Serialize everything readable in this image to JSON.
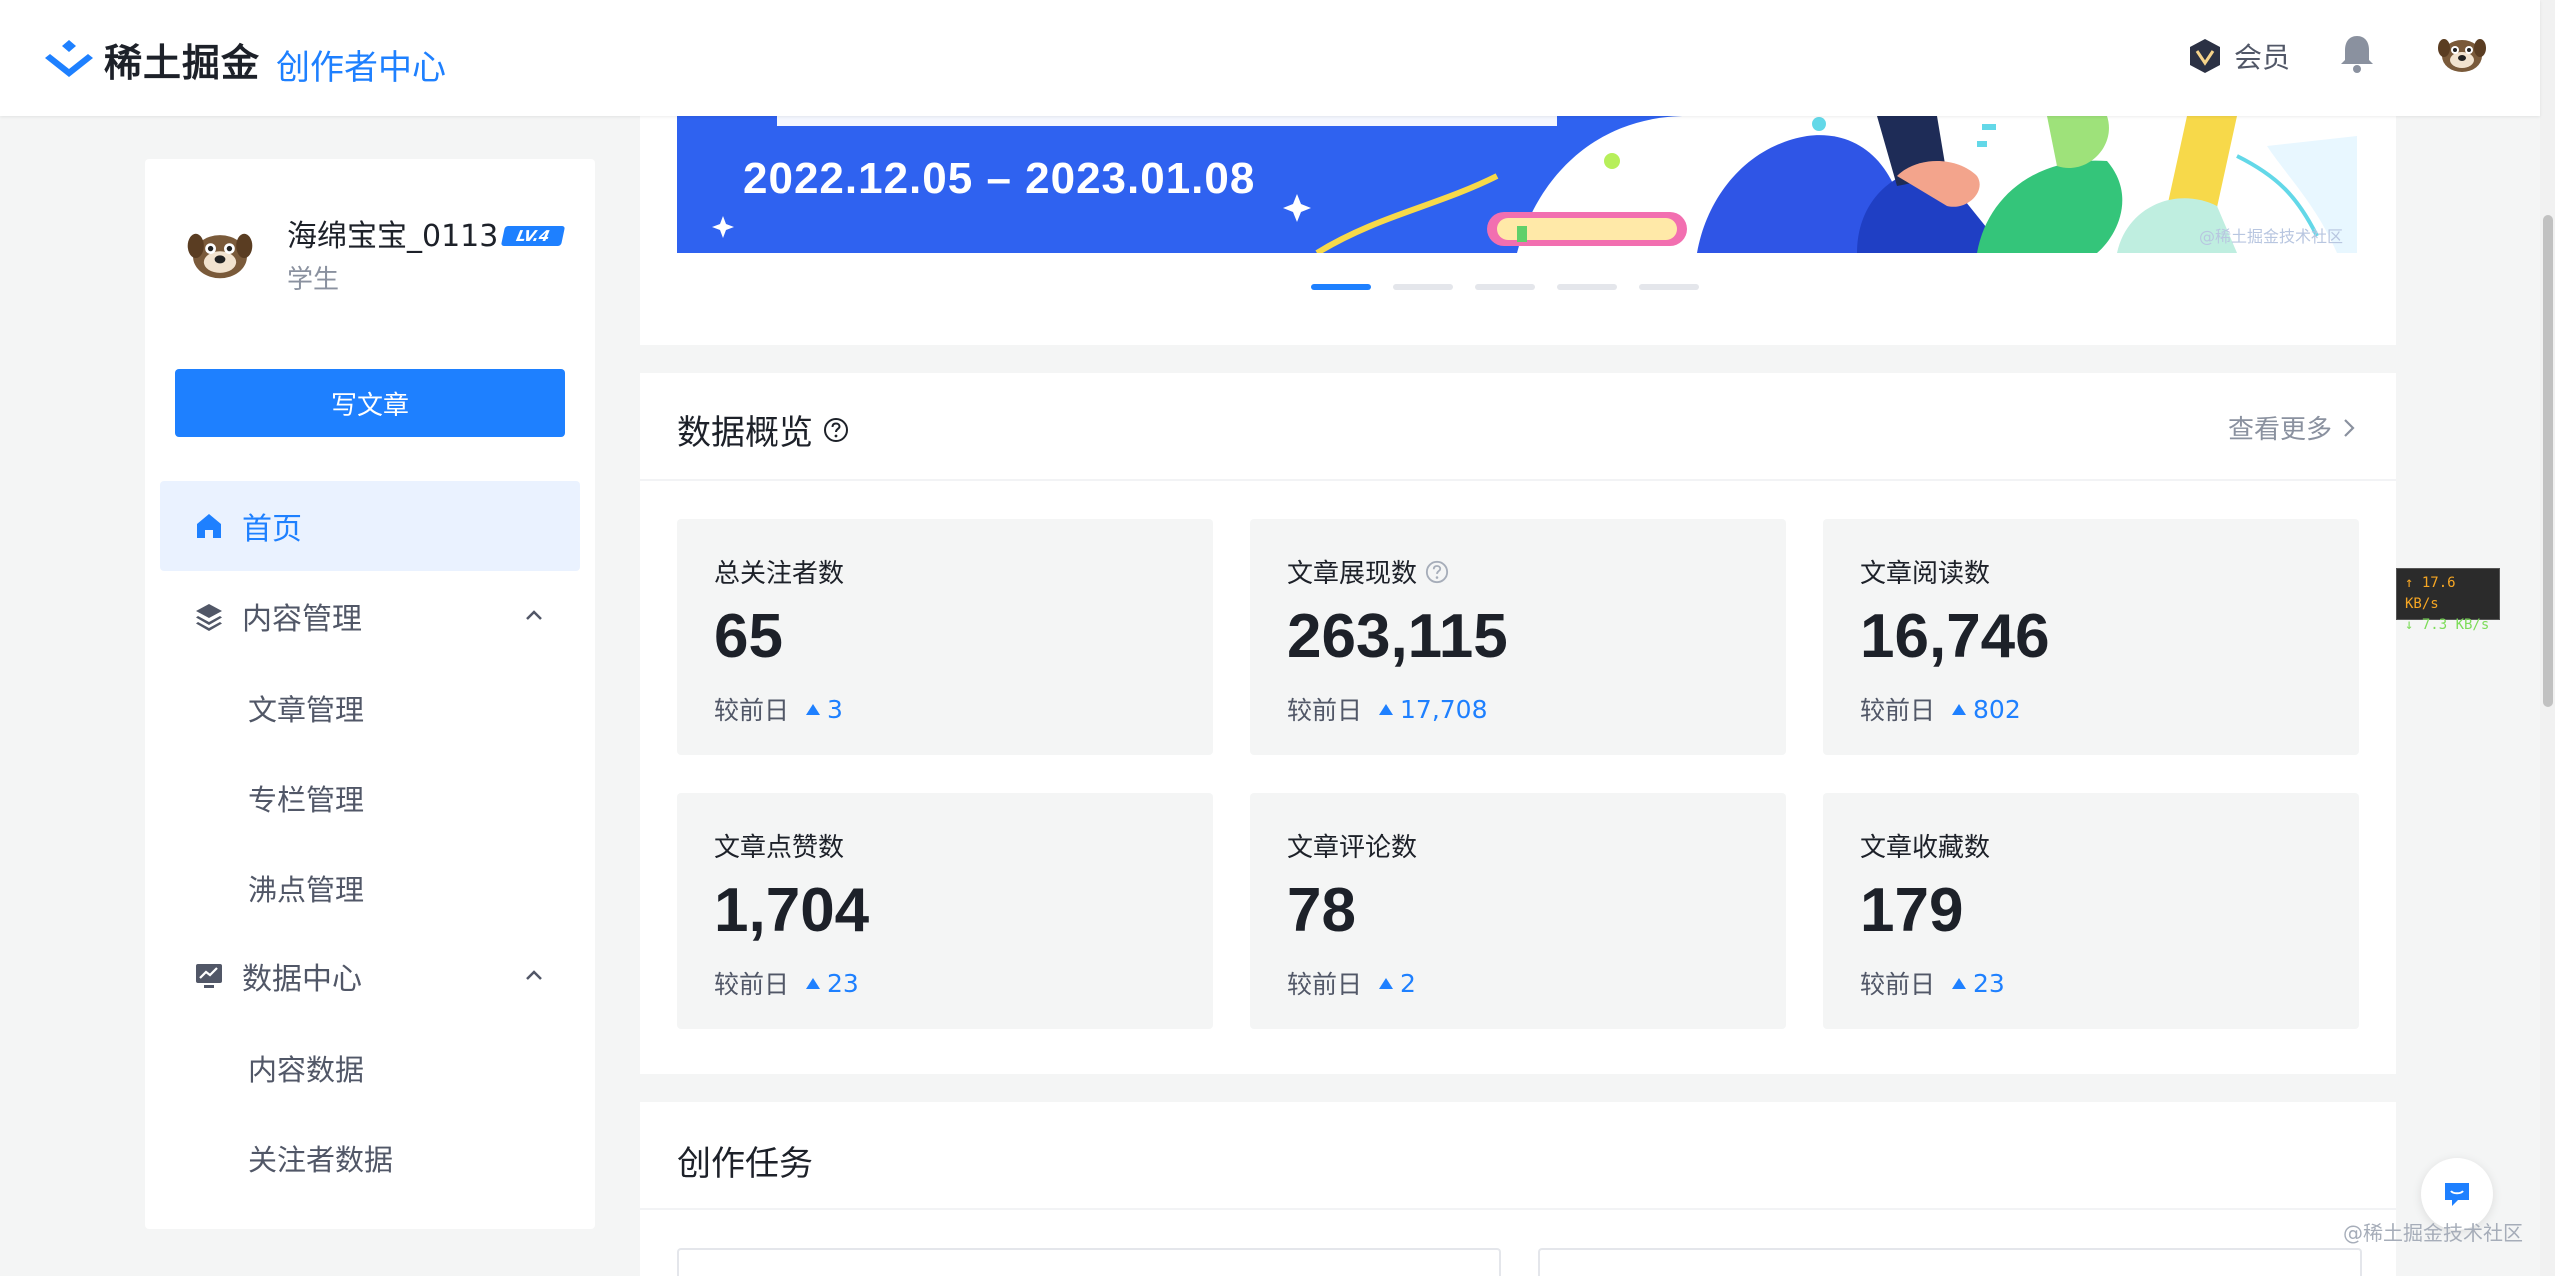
{
  "header": {
    "brand": "稀土掘金",
    "subtitle": "创作者中心",
    "vip_label": "会员"
  },
  "sidebar": {
    "profile": {
      "name": "海绵宝宝_0113",
      "level": "LV.4",
      "role": "学生"
    },
    "write_button": "写文章",
    "nav": [
      {
        "label": "首页",
        "icon": "home-icon",
        "active": true
      },
      {
        "label": "内容管理",
        "icon": "layers-icon",
        "expanded": true
      },
      {
        "label": "数据中心",
        "icon": "chart-icon",
        "expanded": true
      }
    ],
    "content_items": [
      "文章管理",
      "专栏管理",
      "沸点管理"
    ],
    "data_items": [
      "内容数据",
      "关注者数据"
    ]
  },
  "banner": {
    "date_range": "2022.12.05 – 2023.01.08",
    "watermark": "@稀土掘金技术社区",
    "slides": 5,
    "active_slide": 0
  },
  "overview": {
    "title": "数据概览",
    "more": "查看更多",
    "compare_label": "较前日",
    "stats": [
      {
        "label": "总关注者数",
        "value": "65",
        "delta": "3"
      },
      {
        "label": "文章展现数",
        "value": "263,115",
        "delta": "17,708",
        "help": true
      },
      {
        "label": "文章阅读数",
        "value": "16,746",
        "delta": "802"
      },
      {
        "label": "文章点赞数",
        "value": "1,704",
        "delta": "23"
      },
      {
        "label": "文章评论数",
        "value": "78",
        "delta": "2"
      },
      {
        "label": "文章收藏数",
        "value": "179",
        "delta": "23"
      }
    ]
  },
  "tasks": {
    "title": "创作任务"
  },
  "net_speed": {
    "up": "↑ 17.6 KB/s",
    "down": "↓ 7.3 KB/s"
  },
  "page_watermark": "@稀土掘金技术社区",
  "colors": {
    "accent": "#1e80ff",
    "banner": "#2f62f0",
    "background": "#f4f5f5"
  }
}
